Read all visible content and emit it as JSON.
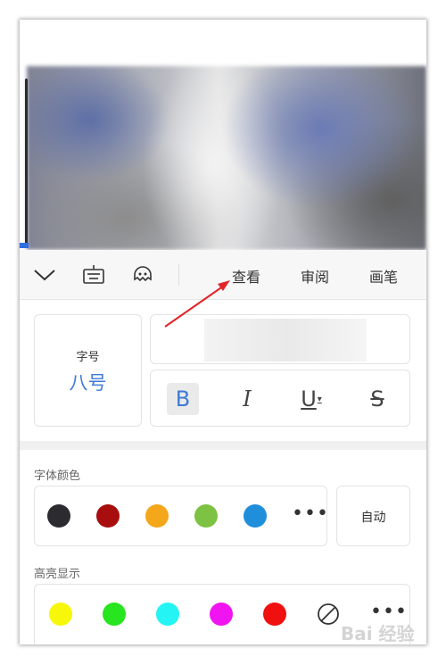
{
  "toolbar": {
    "tabs": [
      {
        "label": "查看"
      },
      {
        "label": "审阅"
      },
      {
        "label": "画笔"
      }
    ]
  },
  "font_size": {
    "label": "字号",
    "value": "八号"
  },
  "format_buttons": {
    "bold": "B",
    "italic": "I",
    "underline": "U",
    "strikethrough": "S"
  },
  "font_color": {
    "label": "字体颜色",
    "swatches": [
      "#2b2b30",
      "#a80e0e",
      "#f5a71b",
      "#7dc242",
      "#1f8fdb"
    ],
    "more": "•••",
    "auto_label": "自动"
  },
  "highlight": {
    "label": "高亮显示",
    "swatches": [
      "#f7f70a",
      "#27e51f",
      "#24f4f4",
      "#f014f0",
      "#f01010"
    ],
    "more": "•••"
  },
  "icons": {
    "collapse": "chevron-down-icon",
    "keyboard": "keyboard-icon",
    "assistant": "assistant-face-icon",
    "no_highlight": "no-color-icon"
  },
  "colors": {
    "accent": "#3e7ad6",
    "annotation_arrow": "#e0262b"
  },
  "watermark": "Bai 经验"
}
